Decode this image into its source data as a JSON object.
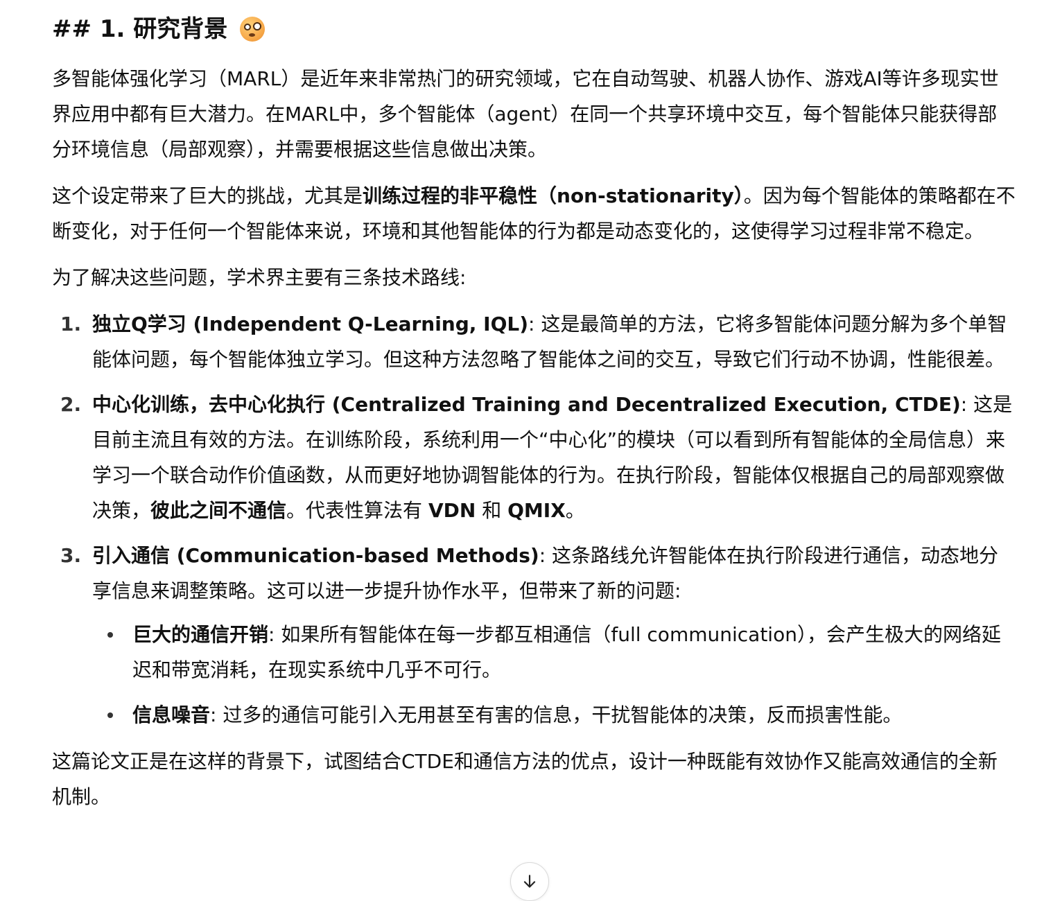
{
  "heading": {
    "text": "## 1. 研究背景",
    "emoji": "face-with-monocle-icon"
  },
  "paragraphs": {
    "p1": "多智能体强化学习（MARL）是近年来非常热门的研究领域，它在自动驾驶、机器人协作、游戏AI等许多现实世界应用中都有巨大潜力。在MARL中，多个智能体（agent）在同一个共享环境中交互，每个智能体只能获得部分环境信息（局部观察），并需要根据这些信息做出决策。",
    "p2_before": "这个设定带来了巨大的挑战，尤其是",
    "p2_bold": "训练过程的非平稳性（non-stationarity）",
    "p2_after": "。因为每个智能体的策略都在不断变化，对于任何一个智能体来说，环境和其他智能体的行为都是动态变化的，这使得学习过程非常不稳定。",
    "p3": "为了解决这些问题，学术界主要有三条技术路线:",
    "p_final": "这篇论文正是在这样的背景下，试图结合CTDE和通信方法的优点，设计一种既能有效协作又能高效通信的全新机制。"
  },
  "routes": [
    {
      "num": "1.",
      "title": "独立Q学习 (Independent Q-Learning, IQL)",
      "text": ": 这是最简单的方法，它将多智能体问题分解为多个单智能体问题，每个智能体独立学习。但这种方法忽略了智能体之间的交互，导致它们行动不协调，性能很差。"
    },
    {
      "num": "2.",
      "title": "中心化训练，去中心化执行 (Centralized Training and Decentralized Execution, CTDE)",
      "text_a": ": 这是目前主流且有效的方法。在训练阶段，系统利用一个“中心化”的模块（可以看到所有智能体的全局信息）来学习一个联合动作价值函数，从而更好地协调智能体的行为。在执行阶段，智能体仅根据自己的局部观察做决策，",
      "bold_a": "彼此之间不通信",
      "text_b": "。代表性算法有 ",
      "bold_b": "VDN",
      "text_c": " 和 ",
      "bold_c": "QMIX",
      "text_d": "。"
    },
    {
      "num": "3.",
      "title": "引入通信 (Communication-based Methods)",
      "text": ": 这条路线允许智能体在执行阶段进行通信，动态地分享信息来调整策略。这可以进一步提升协作水平，但带来了新的问题:",
      "problems": [
        {
          "title": "巨大的通信开销",
          "text": ": 如果所有智能体在每一步都互相通信（full communication），会产生极大的网络延迟和带宽消耗，在现实系统中几乎不可行。"
        },
        {
          "title": "信息噪音",
          "text": ": 过多的通信可能引入无用甚至有害的信息，干扰智能体的决策，反而损害性能。"
        }
      ]
    }
  ],
  "scroll_button": {
    "icon": "arrow-down-icon"
  }
}
